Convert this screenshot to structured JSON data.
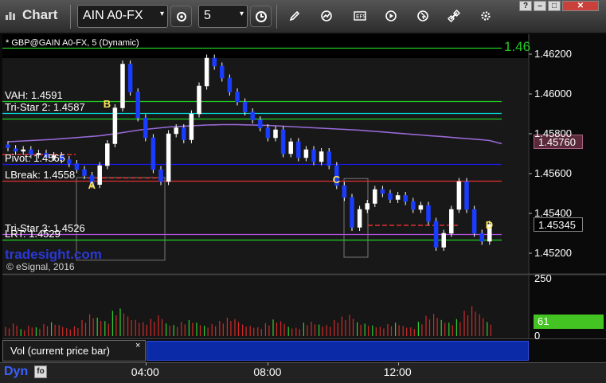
{
  "toolbar": {
    "title": "Chart",
    "symbol": "AIN A0-FX",
    "interval": "5"
  },
  "window_buttons": [
    "?",
    "–",
    "□",
    "✕"
  ],
  "header": {
    "symbol_line": "* GBP@GAIN A0-FX, 5 (Dynamic)"
  },
  "levels": [
    {
      "label": "VAH: 1.4591",
      "price": 1.45965,
      "color": "#22cc22"
    },
    {
      "label": "Tri-Star 2: 1.4587",
      "price": 1.45905,
      "color": "#00d6d6"
    },
    {
      "label": "",
      "price": 1.45878,
      "color": "#22cc22"
    },
    {
      "label": "Pivot: 1.4565",
      "price": 1.45648,
      "color": "#1a1aee"
    },
    {
      "label": "LBreak: 1.4558",
      "price": 1.45563,
      "color": "#e03030"
    },
    {
      "label": "LRT: 1.4529",
      "price": 1.45268,
      "color": "#22cc22"
    },
    {
      "label": "Tri-Star 3: 1.4526",
      "price": 1.45296,
      "color": "#b050e0"
    },
    {
      "label": "",
      "price": 1.46233,
      "color": "#22cc22"
    }
  ],
  "right_green_label": "1.46",
  "markers": [
    {
      "letter": "A",
      "index": 11,
      "price": 1.45535
    },
    {
      "letter": "B",
      "index": 13,
      "price": 1.45945
    },
    {
      "letter": "C",
      "index": 43,
      "price": 1.45565
    },
    {
      "letter": "D",
      "index": 63,
      "price": 1.45335
    }
  ],
  "price_tags": [
    {
      "text": "1.45760",
      "price": 1.4576,
      "bg": "#5a2a3a",
      "fg": "#ffffff",
      "border": "#a36080"
    },
    {
      "text": "1.45345",
      "price": 1.45345,
      "bg": "#000000",
      "fg": "#ffffff",
      "border": "#888888"
    }
  ],
  "volume_tag": {
    "text": "61",
    "value": 61,
    "bg": "#44c422",
    "fg": "#ffffff"
  },
  "watermark": "tradesight.com",
  "copyright": "© eSignal, 2016",
  "volume_pane": {
    "tab_label": "Vol (current price bar)",
    "close": "×"
  },
  "bottom": {
    "dyn": "Dyn",
    "dyn_icon": "fo"
  },
  "chart_data": {
    "type": "candlestick",
    "title": "* GBP@GAIN A0-FX, 5 (Dynamic)",
    "ylim": [
      1.451,
      1.463
    ],
    "yticks": [
      "1.45200",
      "1.45400",
      "1.45600",
      "1.45800",
      "1.46000",
      "1.46200"
    ],
    "xticks": [
      "04:00",
      "08:00",
      "12:00"
    ],
    "xtick_index": [
      18,
      34,
      51
    ],
    "volume_ylim": [
      0,
      250
    ],
    "volume_ticks": [
      "250",
      "0"
    ],
    "candles": [
      [
        1.45745,
        1.4573
      ],
      [
        1.45725,
        1.45712
      ],
      [
        1.45712,
        1.4572
      ],
      [
        1.4572,
        1.45695
      ],
      [
        1.45695,
        1.45702
      ],
      [
        1.45702,
        1.45682
      ],
      [
        1.45682,
        1.4569
      ],
      [
        1.4569,
        1.4567
      ],
      [
        1.4567,
        1.4565
      ],
      [
        1.4565,
        1.4562
      ],
      [
        1.4562,
        1.4559
      ],
      [
        1.4559,
        1.45545
      ],
      [
        1.45545,
        1.4564
      ],
      [
        1.4564,
        1.4575
      ],
      [
        1.4575,
        1.4593
      ],
      [
        1.4593,
        1.4615
      ],
      [
        1.4615,
        1.4601
      ],
      [
        1.4601,
        1.4588
      ],
      [
        1.4588,
        1.4578
      ],
      [
        1.4578,
        1.4562
      ],
      [
        1.4562,
        1.4556
      ],
      [
        1.4556,
        1.458
      ],
      [
        1.458,
        1.4583
      ],
      [
        1.4583,
        1.4577
      ],
      [
        1.4577,
        1.459
      ],
      [
        1.459,
        1.4604
      ],
      [
        1.4604,
        1.4618
      ],
      [
        1.4618,
        1.4614
      ],
      [
        1.4614,
        1.4608
      ],
      [
        1.4608,
        1.4601
      ],
      [
        1.4601,
        1.4596
      ],
      [
        1.4596,
        1.4591
      ],
      [
        1.4591,
        1.4587
      ],
      [
        1.4587,
        1.4583
      ],
      [
        1.4583,
        1.4578
      ],
      [
        1.4578,
        1.4582
      ],
      [
        1.4582,
        1.457
      ],
      [
        1.457,
        1.4576
      ],
      [
        1.4576,
        1.4568
      ],
      [
        1.4568,
        1.4572
      ],
      [
        1.4572,
        1.4566
      ],
      [
        1.4566,
        1.4571
      ],
      [
        1.4571,
        1.4564
      ],
      [
        1.4564,
        1.4554
      ],
      [
        1.4554,
        1.4548
      ],
      [
        1.4548,
        1.4533
      ],
      [
        1.4533,
        1.4542
      ],
      [
        1.4542,
        1.4545
      ],
      [
        1.4545,
        1.4552
      ],
      [
        1.4552,
        1.455
      ],
      [
        1.455,
        1.4547
      ],
      [
        1.4547,
        1.4549
      ],
      [
        1.4549,
        1.4546
      ],
      [
        1.4546,
        1.4542
      ],
      [
        1.4542,
        1.4544
      ],
      [
        1.4544,
        1.4536
      ],
      [
        1.4536,
        1.4523
      ],
      [
        1.4523,
        1.453
      ],
      [
        1.453,
        1.4542
      ],
      [
        1.4542,
        1.4556
      ],
      [
        1.4556,
        1.4542
      ],
      [
        1.4542,
        1.453
      ],
      [
        1.453,
        1.4526
      ],
      [
        1.4526,
        1.45345
      ]
    ],
    "volumes": [
      40,
      55,
      30,
      45,
      38,
      52,
      60,
      48,
      35,
      42,
      70,
      95,
      80,
      65,
      110,
      120,
      85,
      70,
      60,
      75,
      90,
      55,
      48,
      62,
      70,
      58,
      45,
      52,
      66,
      80,
      74,
      50,
      44,
      38,
      56,
      72,
      64,
      40,
      36,
      58,
      62,
      50,
      48,
      70,
      85,
      92,
      60,
      54,
      46,
      40,
      52,
      58,
      44,
      38,
      62,
      88,
      96,
      70,
      58,
      74,
      110,
      130,
      95,
      61
    ],
    "series": [
      {
        "values": [
          1.4576,
          1.45762,
          1.45764,
          1.45766,
          1.45768,
          1.4577,
          1.45772,
          1.45775,
          1.45778,
          1.45781,
          1.45784,
          1.45787,
          1.4579,
          1.45795,
          1.458,
          1.45806,
          1.45812,
          1.45818,
          1.45822,
          1.45826,
          1.4583,
          1.45834,
          1.45836,
          1.45838,
          1.4584,
          1.45842,
          1.45844,
          1.45845,
          1.45846,
          1.45846,
          1.45846,
          1.45845,
          1.45844,
          1.45843,
          1.45842,
          1.4584,
          1.45838,
          1.45836,
          1.45834,
          1.45832,
          1.4583,
          1.45828,
          1.45826,
          1.45824,
          1.45822,
          1.4582,
          1.45818,
          1.45815,
          1.45812,
          1.45809,
          1.45806,
          1.45803,
          1.458,
          1.45797,
          1.45794,
          1.45791,
          1.45788,
          1.45785,
          1.45782,
          1.45779,
          1.45776,
          1.45773,
          1.4577,
          1.45766
        ]
      }
    ]
  }
}
